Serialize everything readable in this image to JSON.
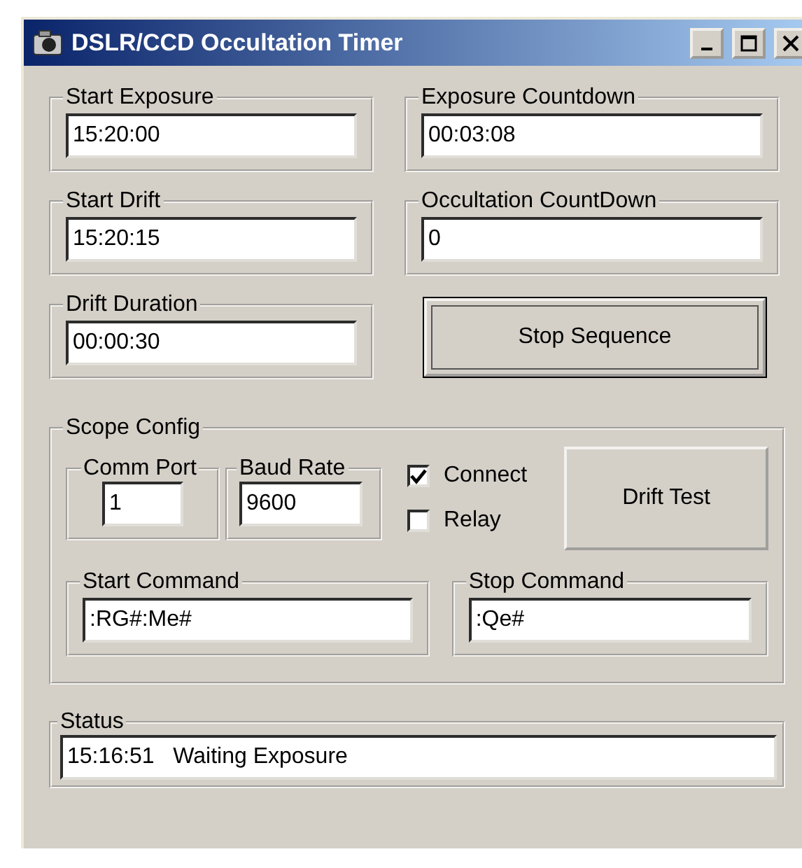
{
  "window": {
    "title": "DSLR/CCD Occultation Timer"
  },
  "timer_groups": [
    {
      "label": "Start Exposure",
      "value": "15:20:00"
    },
    {
      "label": "Exposure Countdown",
      "value": "00:03:08"
    },
    {
      "label": "Start Drift",
      "value": "15:20:15"
    },
    {
      "label": "Occultation CountDown",
      "value": "0"
    },
    {
      "label": "Drift Duration",
      "value": "00:00:30"
    }
  ],
  "sequence_button": {
    "label": "Stop Sequence",
    "focused": true
  },
  "scope_config": {
    "title": "Scope Config",
    "comm_port": {
      "label": "Comm Port",
      "value": "1"
    },
    "baud_rate": {
      "label": "Baud Rate",
      "value": "9600"
    },
    "checkboxes": [
      {
        "label": "Connect",
        "checked": true
      },
      {
        "label": "Relay",
        "checked": false
      }
    ],
    "drift_test_button": "Drift Test",
    "start_command": {
      "label": "Start Command",
      "value": ":RG#:Me#"
    },
    "stop_command": {
      "label": "Stop Command",
      "value": ":Qe#"
    }
  },
  "status": {
    "label": "Status",
    "value": "15:16:51   Waiting Exposure"
  }
}
